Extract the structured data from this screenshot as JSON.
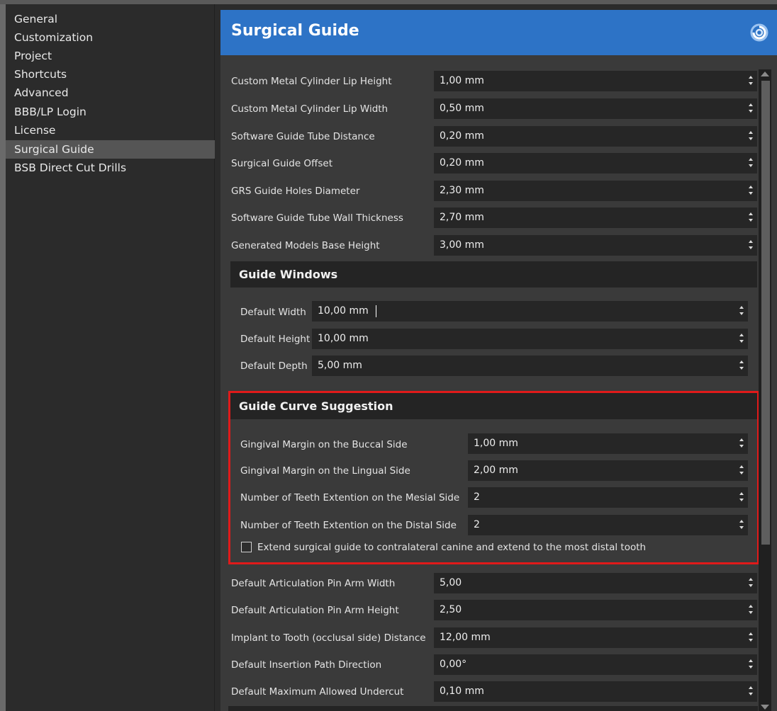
{
  "sidebar": {
    "items": [
      {
        "label": "General"
      },
      {
        "label": "Customization"
      },
      {
        "label": "Project"
      },
      {
        "label": "Shortcuts"
      },
      {
        "label": "Advanced"
      },
      {
        "label": "BBB/LP Login"
      },
      {
        "label": "License"
      },
      {
        "label": "Surgical Guide",
        "selected": true
      },
      {
        "label": "BSB Direct Cut Drills"
      }
    ]
  },
  "header": {
    "title": "Surgical Guide",
    "logo_icon": "spiral-logo-icon"
  },
  "settings_top": [
    {
      "label": "Custom Metal Cylinder Lip Height",
      "value": "1,00 mm"
    },
    {
      "label": "Custom Metal Cylinder Lip Width",
      "value": "0,50 mm"
    },
    {
      "label": "Software Guide Tube Distance",
      "value": "0,20 mm"
    },
    {
      "label": "Surgical Guide Offset",
      "value": "0,20 mm"
    },
    {
      "label": "GRS Guide Holes Diameter",
      "value": "2,30 mm"
    },
    {
      "label": "Software Guide Tube Wall Thickness",
      "value": "2,70 mm"
    },
    {
      "label": "Generated Models Base Height",
      "value": "3,00 mm"
    }
  ],
  "guide_windows": {
    "title": "Guide Windows",
    "rows": [
      {
        "label": "Default Width",
        "value": "10,00 mm"
      },
      {
        "label": "Default Height",
        "value": "10,00 mm"
      },
      {
        "label": "Default Depth",
        "value": "5,00 mm"
      }
    ]
  },
  "guide_curve": {
    "title": "Guide Curve Suggestion",
    "rows": [
      {
        "label": "Gingival Margin on the Buccal Side",
        "value": "1,00 mm"
      },
      {
        "label": "Gingival Margin on the Lingual Side",
        "value": "2,00 mm"
      },
      {
        "label": "Number of Teeth Extention on the Mesial Side",
        "value": "2"
      },
      {
        "label": "Number of Teeth Extention on the Distal Side",
        "value": "2"
      }
    ],
    "checkbox": {
      "label": "Extend surgical guide to contralateral canine and extend to the most distal tooth",
      "checked": false
    },
    "highlight_color": "#e01a1a"
  },
  "settings_bottom": [
    {
      "label": "Default Articulation Pin Arm Width",
      "value": "5,00"
    },
    {
      "label": "Default Articulation Pin Arm Height",
      "value": "2,50"
    },
    {
      "label": "Implant to Tooth (occlusal side) Distance",
      "value": "12,00 mm"
    },
    {
      "label": "Default Insertion Path Direction",
      "value": "0,00°"
    },
    {
      "label": "Default Maximum Allowed Undercut",
      "value": "0,10 mm"
    }
  ],
  "colors": {
    "header_bg": "#2d73c6",
    "panel_bg": "#3a3a3a",
    "sidebar_bg": "#2b2b2b",
    "input_bg": "#262626"
  }
}
